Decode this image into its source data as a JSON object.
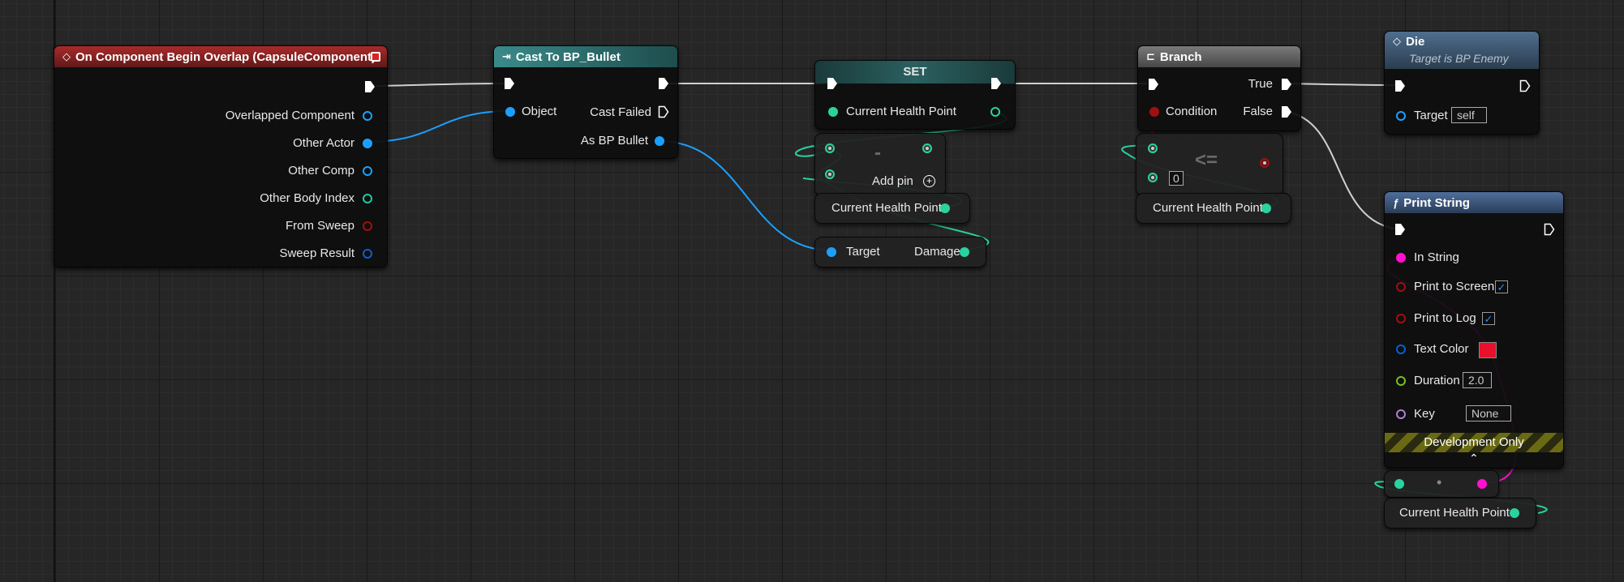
{
  "colors": {
    "exec": "#ffffff",
    "object": "#1ba0ff",
    "float": "#2ad2a0",
    "int": "#22c8a0",
    "bool": "#a01010",
    "struct": "#0a60d0",
    "string": "#ff10d0",
    "duration": "#76c020",
    "name": "#b080d0",
    "event_header": "#a92a2a",
    "cast_header": "#2f7a7a",
    "function_header": "#3d5a80"
  },
  "event_node": {
    "title": "On Component Begin Overlap (CapsuleComponent)",
    "icon": "event-diamond-icon",
    "pins": [
      "Overlapped Component",
      "Other Actor",
      "Other Comp",
      "Other Body Index",
      "From Sweep",
      "Sweep Result"
    ]
  },
  "cast_node": {
    "title": "Cast To BP_Bullet",
    "icon": "cast-arrow-icon",
    "object_label": "Object",
    "cast_failed_label": "Cast Failed",
    "as_label": "As BP Bullet"
  },
  "set_node": {
    "title": "SET",
    "pin_label": "Current Health Point"
  },
  "subtract_node": {
    "symbol": "-",
    "add_pin_label": "Add pin"
  },
  "get_current_hp_1": {
    "label": "Current Health Point"
  },
  "target_damage_node": {
    "target_label": "Target",
    "damage_label": "Damage"
  },
  "branch_node": {
    "title": "Branch",
    "condition_label": "Condition",
    "true_label": "True",
    "false_label": "False"
  },
  "compare_node": {
    "symbol": "<=",
    "value": "0"
  },
  "get_current_hp_2": {
    "label": "Current Health Point"
  },
  "die_node": {
    "title": "Die",
    "subtitle": "Target is BP Enemy",
    "target_label": "Target",
    "target_value": "self"
  },
  "print_node": {
    "title": "Print String",
    "icon": "function-icon",
    "in_string_label": "In String",
    "print_screen_label": "Print to Screen",
    "print_log_label": "Print to Log",
    "text_color_label": "Text Color",
    "text_color_value": "#e8102a",
    "duration_label": "Duration",
    "duration_value": "2.0",
    "key_label": "Key",
    "key_value": "None",
    "dev_only_label": "Development Only"
  },
  "conv_node": {
    "symbol": "•"
  },
  "get_current_hp_3": {
    "label": "Current Health Point"
  }
}
